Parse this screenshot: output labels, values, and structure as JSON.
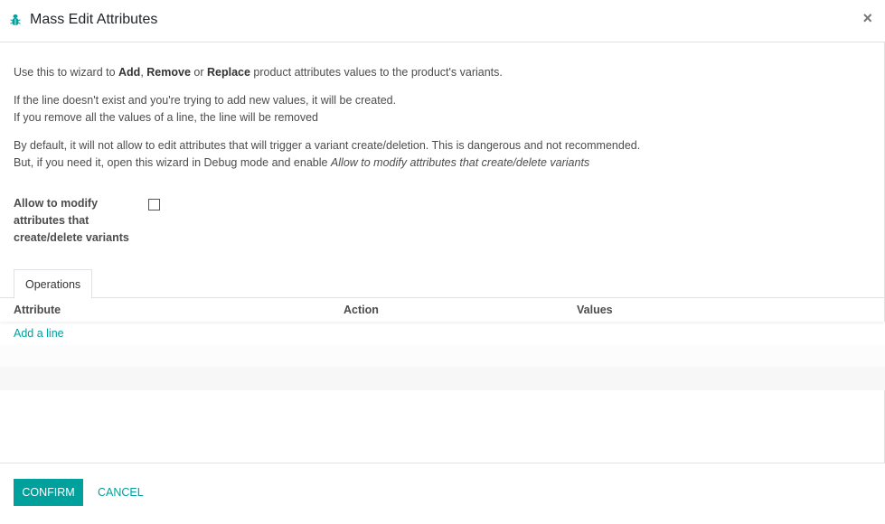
{
  "header": {
    "title": "Mass Edit Attributes",
    "icon": "bug-icon",
    "close_label": "×"
  },
  "body": {
    "intro": {
      "prefix": "Use this to wizard to ",
      "add": "Add",
      "sep1": ", ",
      "remove": "Remove",
      "sep2": " or ",
      "replace": "Replace",
      "suffix": " product attributes values to the product's variants."
    },
    "line_info_1": "If the line doesn't exist and you're trying to add new values, it will be created.",
    "line_info_2": "If you remove all the values of a line, the line will be removed",
    "default_info": "By default, it will not allow to edit attributes that will trigger a variant create/deletion. This is dangerous and not recommended.",
    "debug_info_prefix": "But, if you need it, open this wizard in Debug mode and enable ",
    "debug_info_em": "Allow to modify attributes that create/delete variants",
    "allow_field_label": "Allow to modify attributes that create/delete variants",
    "allow_field_checked": false
  },
  "tabs": [
    {
      "label": "Operations",
      "active": true
    }
  ],
  "table": {
    "columns": [
      "Attribute",
      "Action",
      "Values"
    ],
    "add_line_label": "Add a line"
  },
  "footer": {
    "confirm_label": "Confirm",
    "cancel_label": "Cancel"
  },
  "colors": {
    "accent": "#00a09d"
  }
}
